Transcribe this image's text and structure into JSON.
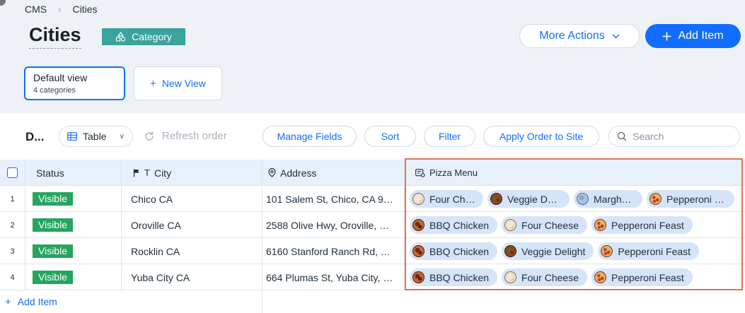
{
  "breadcrumb": {
    "root": "CMS",
    "current": "Cities"
  },
  "page": {
    "title": "Cities",
    "category_badge": "Category"
  },
  "actions": {
    "more_actions": "More Actions",
    "add_item": "Add Item"
  },
  "views": {
    "default": {
      "name": "Default view",
      "subtitle": "4 categories"
    },
    "new_view": "New View"
  },
  "toolbar": {
    "title": "D...",
    "view_type": "Table",
    "refresh": "Refresh order",
    "manage_fields": "Manage Fields",
    "sort": "Sort",
    "filter": "Filter",
    "apply_order": "Apply Order to Site",
    "search_placeholder": "Search"
  },
  "columns": {
    "status": "Status",
    "city": "City",
    "address": "Address",
    "pizza_menu": "Pizza Menu"
  },
  "rows": [
    {
      "num": "1",
      "status": "Visible",
      "city": "Chico CA",
      "address": "101 Salem St, Chico, CA 9…",
      "menu": [
        {
          "label": "Four Ch…",
          "icon": "four"
        },
        {
          "label": "Veggie D…",
          "icon": "veg"
        },
        {
          "label": "Margh…",
          "icon": "mar"
        },
        {
          "label": "Pepperoni …",
          "icon": "pep"
        }
      ]
    },
    {
      "num": "2",
      "status": "Visible",
      "city": "Oroville CA",
      "address": "2588 Olive Hwy, Oroville, …",
      "menu": [
        {
          "label": "BBQ Chicken",
          "icon": "bbq"
        },
        {
          "label": "Four Cheese",
          "icon": "four"
        },
        {
          "label": "Pepperoni Feast",
          "icon": "pep"
        }
      ]
    },
    {
      "num": "3",
      "status": "Visible",
      "city": "Rocklin CA",
      "address": "6160 Stanford Ranch Rd, …",
      "menu": [
        {
          "label": "BBQ Chicken",
          "icon": "bbq"
        },
        {
          "label": "Veggie Delight",
          "icon": "veg"
        },
        {
          "label": "Pepperoni Feast",
          "icon": "pep"
        }
      ]
    },
    {
      "num": "4",
      "status": "Visible",
      "city": "Yuba City CA",
      "address": "664 Plumas St, Yuba City, …",
      "menu": [
        {
          "label": "BBQ Chicken",
          "icon": "bbq"
        },
        {
          "label": "Four Cheese",
          "icon": "four"
        },
        {
          "label": "Pepperoni Feast",
          "icon": "pep"
        }
      ]
    }
  ],
  "footer": {
    "add_item": "Add Item"
  },
  "colors": {
    "accent": "#116dff",
    "status_visible": "#25a55f",
    "category": "#3aa39b",
    "highlight": "#e8725c"
  }
}
